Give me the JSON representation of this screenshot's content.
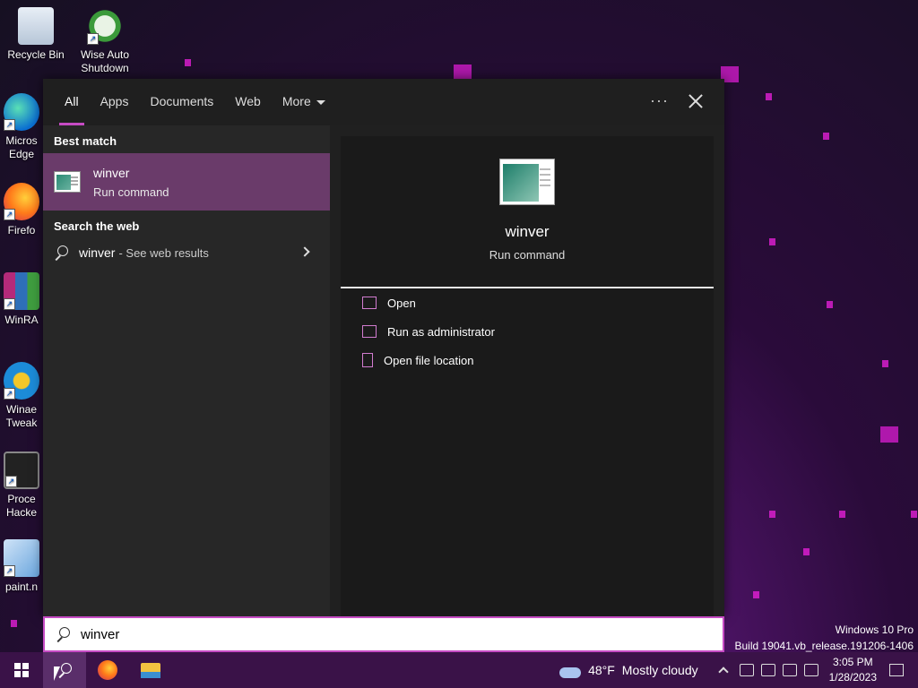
{
  "desktop": {
    "icons": [
      {
        "label": "Recycle Bin",
        "icon": "recycle-bin-icon"
      },
      {
        "label": "Wise Auto Shutdown",
        "icon": "wise-auto-shutdown-icon"
      },
      {
        "label": "Micros Edge",
        "icon": "edge-icon"
      },
      {
        "label": "Firefo",
        "icon": "firefox-icon"
      },
      {
        "label": "WinRA",
        "icon": "winrar-icon"
      },
      {
        "label": "Winae Tweak",
        "icon": "winaero-tweaker-icon"
      },
      {
        "label": "Proce Hacke",
        "icon": "process-hacker-icon"
      },
      {
        "label": "paint.n",
        "icon": "paint-net-icon"
      }
    ],
    "watermark": {
      "line1": "Windows 10 Pro",
      "line2": "Build 19041.vb_release.191206-1406"
    }
  },
  "search_panel": {
    "tabs": [
      {
        "label": "All",
        "active": true
      },
      {
        "label": "Apps"
      },
      {
        "label": "Documents"
      },
      {
        "label": "Web"
      },
      {
        "label": "More"
      }
    ],
    "more_options": "···",
    "best_match_title": "Best match",
    "best_match": {
      "name": "winver",
      "type": "Run command"
    },
    "search_web_title": "Search the web",
    "web_result": {
      "query": "winver",
      "suffix": "- See web results"
    },
    "detail": {
      "name": "winver",
      "type": "Run command",
      "actions": [
        {
          "label": "Open",
          "icon": "open-icon"
        },
        {
          "label": "Run as administrator",
          "icon": "shield-admin-icon"
        },
        {
          "label": "Open file location",
          "icon": "file-location-icon"
        }
      ]
    }
  },
  "search_box": {
    "value": "winver"
  },
  "taskbar": {
    "weather": {
      "temp": "48°F",
      "condition": "Mostly cloudy"
    },
    "clock": {
      "time": "3:05 PM",
      "date": "1/28/2023"
    }
  }
}
